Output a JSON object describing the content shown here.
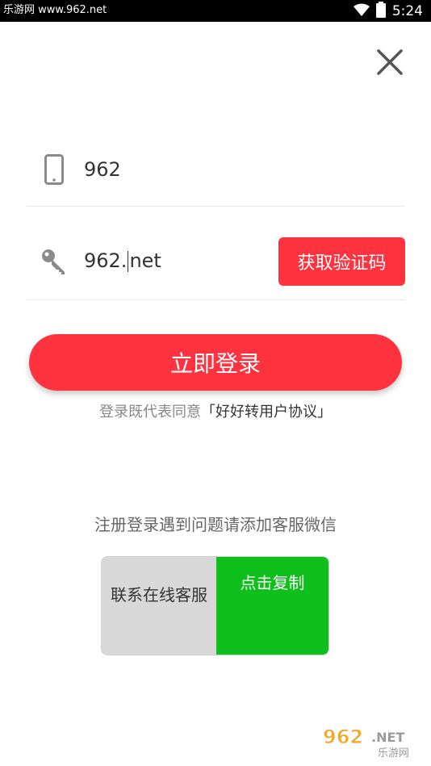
{
  "statusbar": {
    "left_text": "乐游网 www.962.net",
    "time": "5:24"
  },
  "phone_field": {
    "value": "962"
  },
  "code_field": {
    "value_before_caret": "962.",
    "value_after_caret": "net"
  },
  "get_code_button": {
    "label": "获取验证码"
  },
  "login_button": {
    "label": "立即登录"
  },
  "agreement": {
    "prefix": "登录既代表同意",
    "link": "「好好转用户协议」"
  },
  "help_text": "注册登录遇到问题请添加客服微信",
  "contact": {
    "left_label": "联系在线客服",
    "right_label": "点击复制"
  },
  "watermark": {
    "text": "962.NET",
    "sub": "乐游网"
  },
  "colors": {
    "accent_red": "#ff3340",
    "copy_green": "#0fc01d"
  },
  "icons": [
    "wifi-icon",
    "battery-icon",
    "close-icon",
    "phone-icon",
    "key-icon"
  ]
}
